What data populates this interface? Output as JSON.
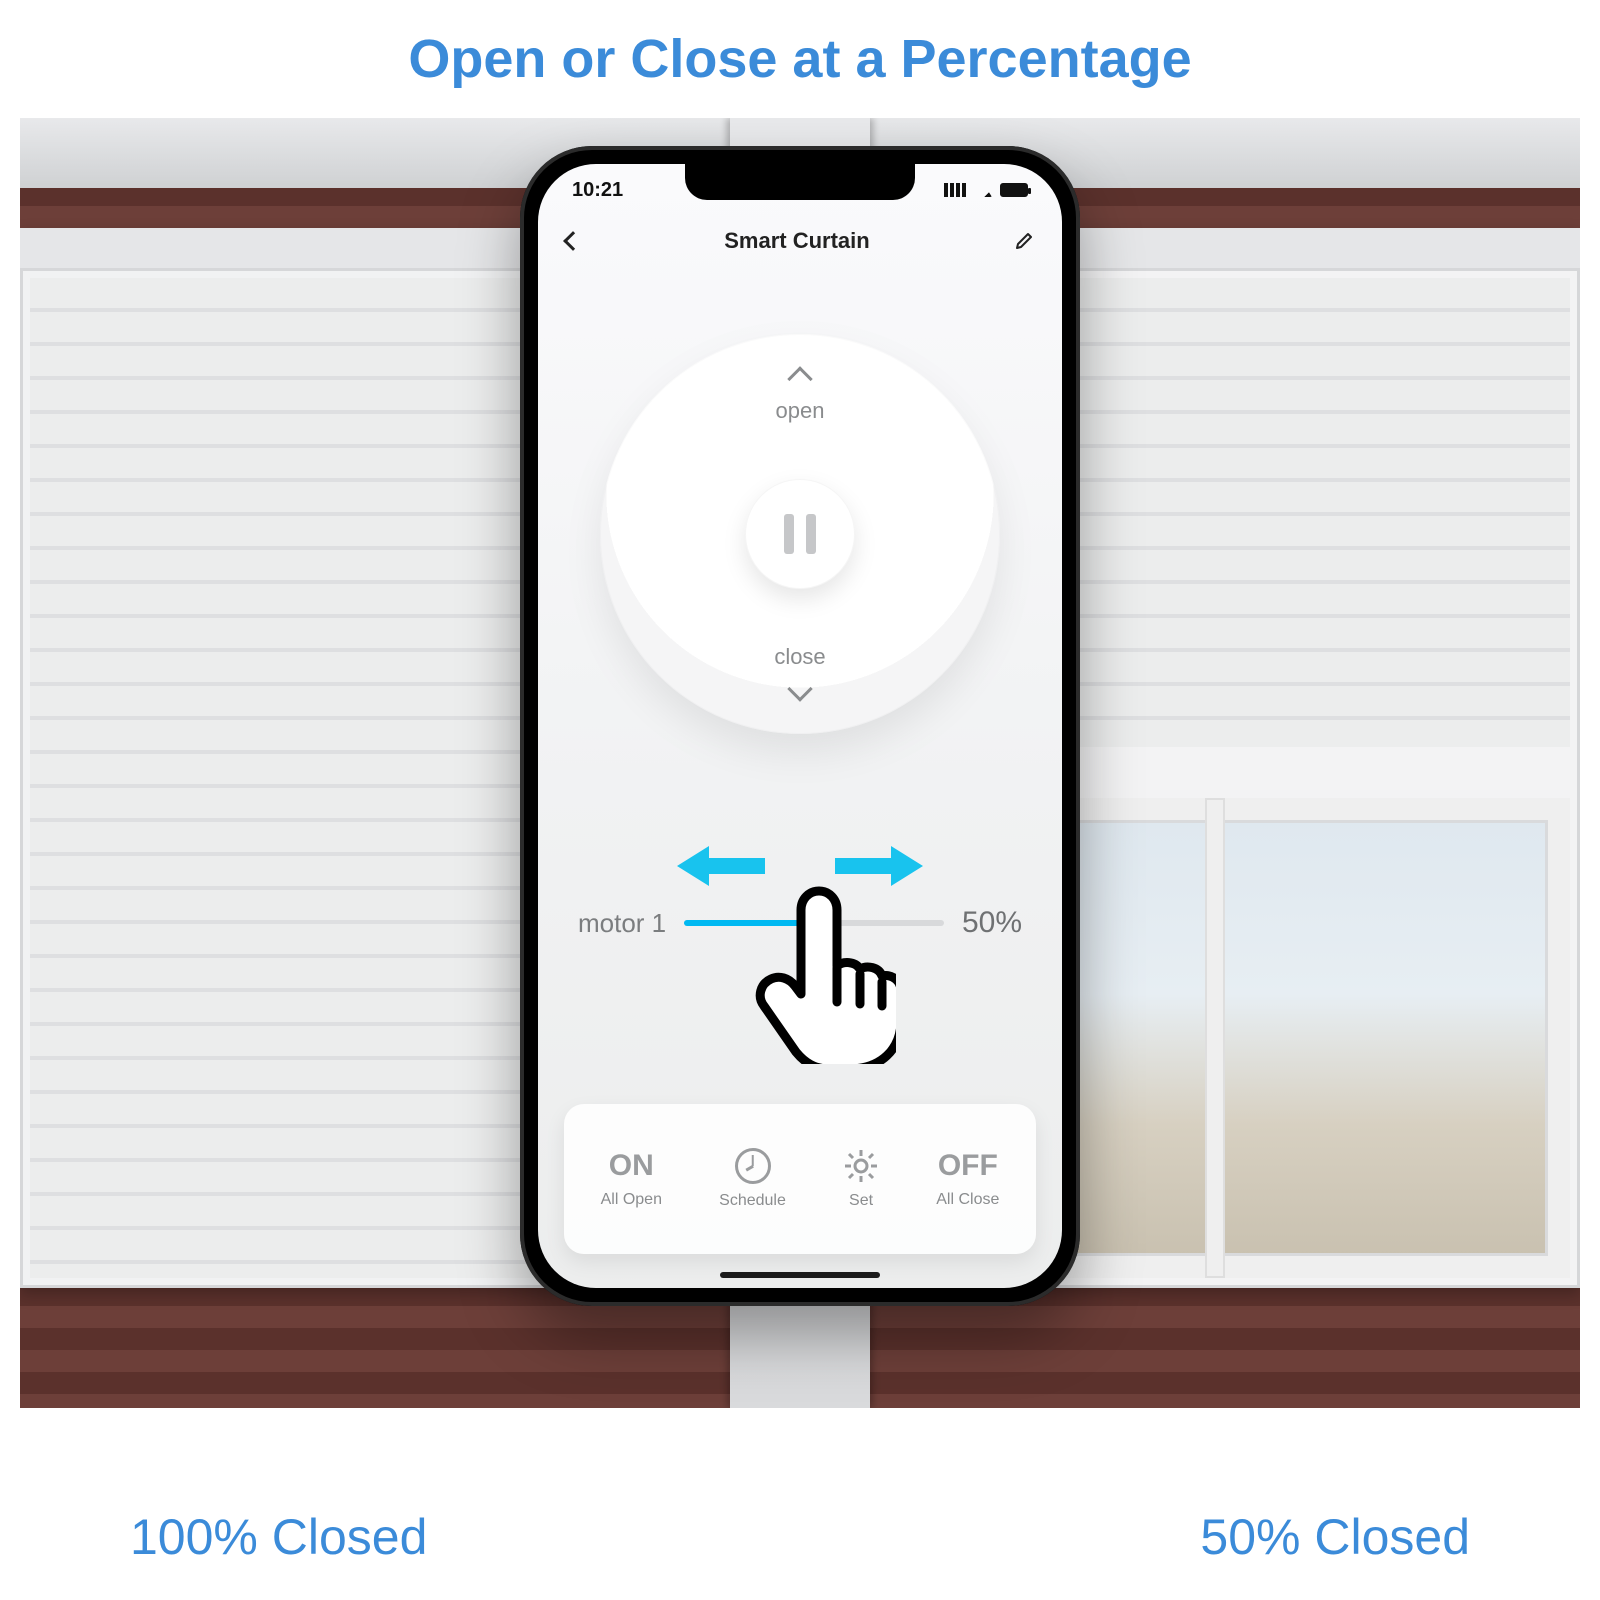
{
  "heading": "Open or Close at a Percentage",
  "captions": {
    "left": "100% Closed",
    "right": "50% Closed"
  },
  "status_bar": {
    "time": "10:21"
  },
  "nav": {
    "title": "Smart Curtain"
  },
  "dial": {
    "open_label": "open",
    "close_label": "close"
  },
  "slider": {
    "motor_label": "motor 1",
    "percent_label": "50%",
    "percent_value": 50
  },
  "bottom_bar": {
    "on_label": "ON",
    "on_sub": "All Open",
    "schedule_label": "Schedule",
    "set_label": "Set",
    "off_label": "OFF",
    "off_sub": "All Close"
  },
  "colors": {
    "accent": "#00b9f2",
    "link": "#3b8bd9"
  }
}
